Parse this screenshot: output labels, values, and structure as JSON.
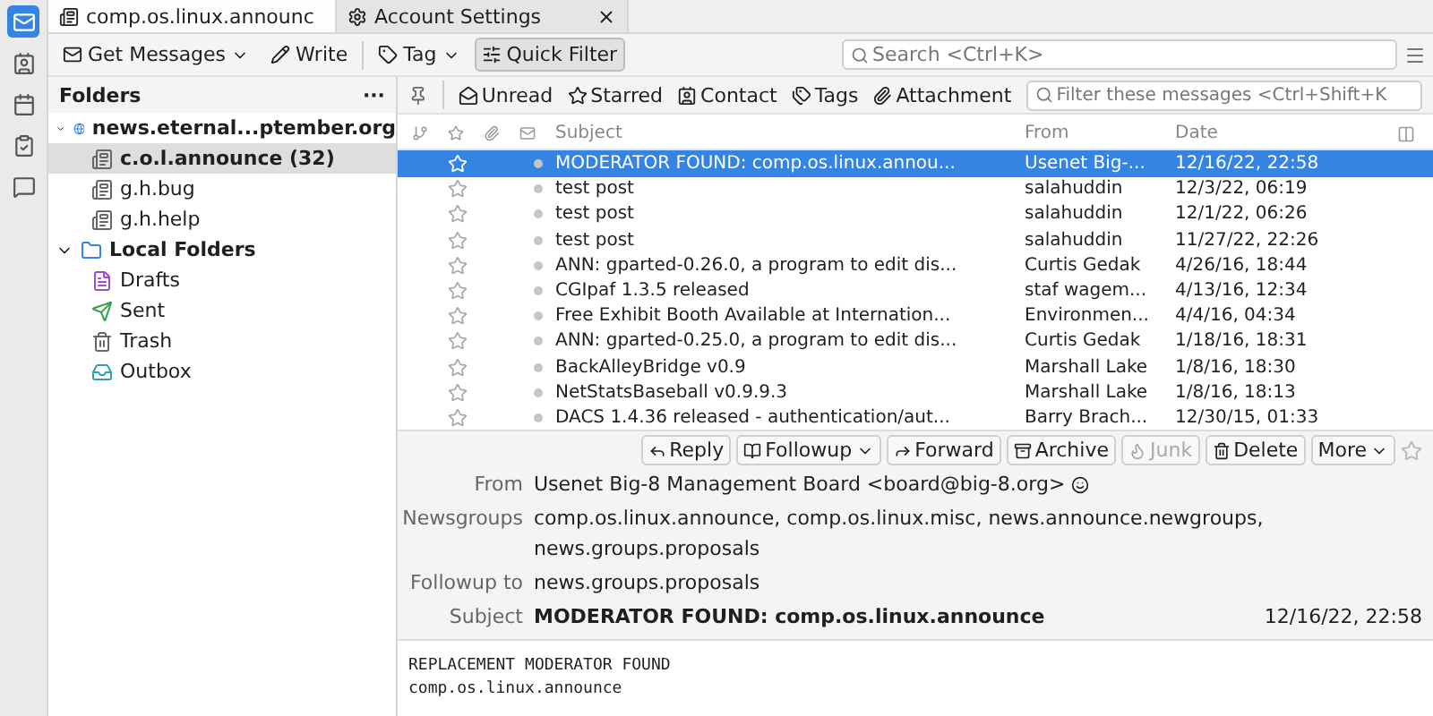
{
  "tabs": [
    {
      "label": "comp.os.linux.announc",
      "selected": true,
      "kind": "folder"
    },
    {
      "label": "Account Settings",
      "selected": false,
      "kind": "settings",
      "closable": true
    }
  ],
  "toolbar": {
    "buttons": [
      {
        "label": "Get Messages",
        "kind": "get",
        "dropdown": true,
        "pressed": false
      },
      {
        "label": "Write",
        "kind": "write",
        "dropdown": false,
        "pressed": false
      },
      {
        "label": "Tag",
        "kind": "tag",
        "dropdown": true,
        "pressed": false
      },
      {
        "label": "Quick Filter",
        "kind": "filter",
        "dropdown": false,
        "pressed": true
      }
    ],
    "search": {
      "placeholder": "Search <Ctrl+K>"
    }
  },
  "folders": {
    "title": "Folders",
    "more": "···",
    "items": [
      {
        "label": "news.eternal...ptember.org",
        "kind": "server",
        "expanded": true,
        "selected": false,
        "bold": true,
        "children": [
          {
            "label": "c.o.l.announce (32)",
            "kind": "newsgroup",
            "selected": true,
            "bold": true
          },
          {
            "label": "g.h.bug",
            "kind": "newsgroup",
            "selected": false,
            "bold": false
          },
          {
            "label": "g.h.help",
            "kind": "newsgroup",
            "selected": false,
            "bold": false
          }
        ]
      },
      {
        "label": "Local Folders",
        "kind": "local",
        "expanded": true,
        "selected": false,
        "bold": true,
        "children": [
          {
            "label": "Drafts",
            "kind": "drafts",
            "selected": false,
            "bold": false
          },
          {
            "label": "Sent",
            "kind": "sent",
            "selected": false,
            "bold": false
          },
          {
            "label": "Trash",
            "kind": "trash",
            "selected": false,
            "bold": false
          },
          {
            "label": "Outbox",
            "kind": "outbox",
            "selected": false,
            "bold": false
          }
        ]
      }
    ]
  },
  "quick_filter": {
    "buttons": [
      {
        "label": "Unread",
        "kind": "unread"
      },
      {
        "label": "Starred",
        "kind": "starred"
      },
      {
        "label": "Contact",
        "kind": "contact"
      },
      {
        "label": "Tags",
        "kind": "tags"
      },
      {
        "label": "Attachment",
        "kind": "attachment"
      }
    ],
    "placeholder": "Filter these messages <Ctrl+Shift+K"
  },
  "table": {
    "columns": [
      "Subject",
      "From",
      "Date"
    ],
    "rows": [
      {
        "subject": "MODERATOR FOUND: comp.os.linux.annou...",
        "from": "Usenet Big-...",
        "date": "12/16/22, 22:58",
        "selected": true,
        "starred": false
      },
      {
        "subject": "test post",
        "from": "salahuddin",
        "date": "12/3/22, 06:19",
        "selected": false,
        "starred": false
      },
      {
        "subject": "test post",
        "from": "salahuddin",
        "date": "12/1/22, 06:26",
        "selected": false,
        "starred": false
      },
      {
        "subject": "test post",
        "from": "salahuddin",
        "date": "11/27/22, 22:26",
        "selected": false,
        "starred": false
      },
      {
        "subject": "ANN: gparted-0.26.0, a program to edit dis...",
        "from": "Curtis Gedak",
        "date": "4/26/16, 18:44",
        "selected": false,
        "starred": false
      },
      {
        "subject": "CGIpaf 1.3.5 released",
        "from": "staf wagem...",
        "date": "4/13/16, 12:34",
        "selected": false,
        "starred": false
      },
      {
        "subject": "Free Exhibit Booth Available at Internation...",
        "from": "Environmen...",
        "date": "4/4/16, 04:34",
        "selected": false,
        "starred": false
      },
      {
        "subject": "ANN: gparted-0.25.0, a program to edit dis...",
        "from": "Curtis Gedak",
        "date": "1/18/16, 18:31",
        "selected": false,
        "starred": false
      },
      {
        "subject": "BackAlleyBridge v0.9",
        "from": "Marshall Lake",
        "date": "1/8/16, 18:30",
        "selected": false,
        "starred": false
      },
      {
        "subject": "NetStatsBaseball v0.9.9.3",
        "from": "Marshall Lake",
        "date": "1/8/16, 18:13",
        "selected": false,
        "starred": false
      },
      {
        "subject": "DACS 1.4.36 released - authentication/aut...",
        "from": "Barry Brach...",
        "date": "12/30/15, 01:33",
        "selected": false,
        "starred": false
      }
    ]
  },
  "message": {
    "actions": [
      {
        "label": "Reply",
        "kind": "reply",
        "disabled": false
      },
      {
        "label": "Followup",
        "kind": "followup",
        "disabled": false,
        "dropdown": true
      },
      {
        "label": "Forward",
        "kind": "forward",
        "disabled": false
      },
      {
        "label": "Archive",
        "kind": "archive",
        "disabled": false
      },
      {
        "label": "Junk",
        "kind": "junk",
        "disabled": true
      },
      {
        "label": "Delete",
        "kind": "delete",
        "disabled": false
      },
      {
        "label": "More",
        "kind": "more",
        "disabled": false,
        "dropdown": true
      }
    ],
    "starred": false,
    "fields": [
      {
        "label": "From",
        "lines": [
          "Usenet Big-8 Management Board <board@big-8.org>"
        ],
        "kind": "from"
      },
      {
        "label": "Newsgroups",
        "lines": [
          "comp.os.linux.announce, comp.os.linux.misc, news.announce.newgroups,",
          "news.groups.proposals"
        ],
        "kind": "plain"
      },
      {
        "label": "Followup to",
        "lines": [
          "news.groups.proposals"
        ],
        "kind": "plain"
      },
      {
        "label": "Subject",
        "lines": [
          "MODERATOR FOUND: comp.os.linux.announce"
        ],
        "kind": "subject",
        "date": "12/16/22, 22:58"
      }
    ],
    "body": [
      "REPLACEMENT MODERATOR FOUND",
      "comp.os.linux.announce"
    ]
  }
}
